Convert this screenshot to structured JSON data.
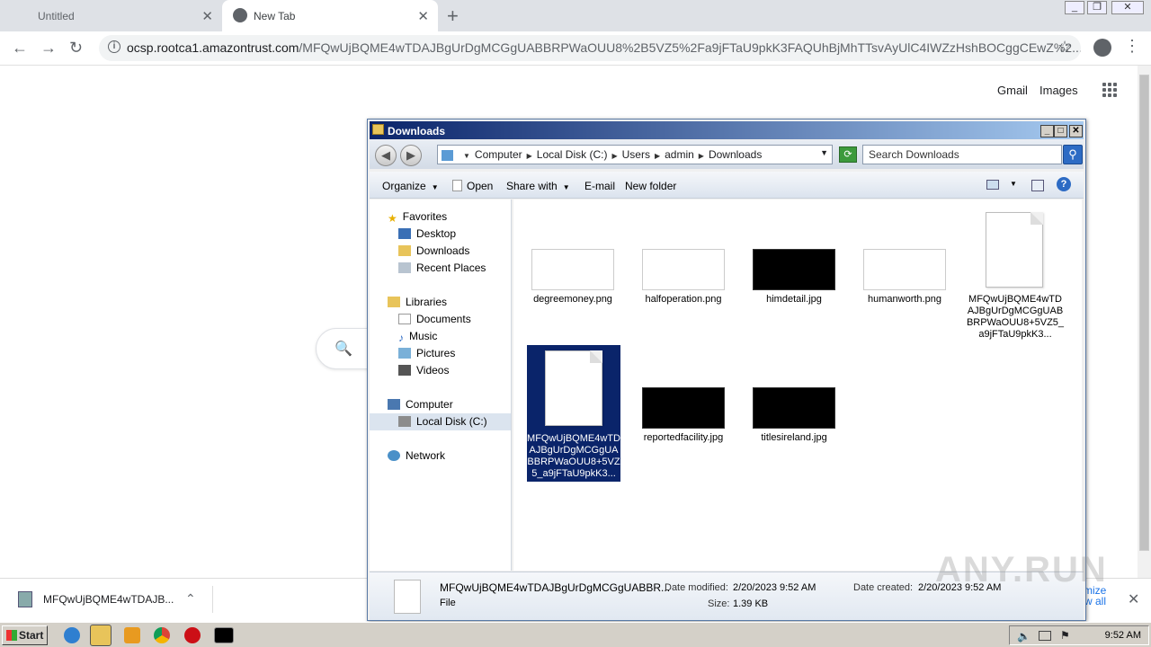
{
  "browser": {
    "tabs": [
      {
        "label": "Untitled"
      },
      {
        "label": "New Tab"
      }
    ],
    "url_host": "ocsp.rootca1.amazontrust.com",
    "url_path": "/MFQwUjBQME4wTDAJBgUrDgMCGgUABBRPWaOUU8%2B5VZ5%2Fa9jFTaU9pkK3FAQUhBjMhTTsvAyUlC4IWZzHshBOCggCEwZ%2..."
  },
  "page": {
    "gmail": "Gmail",
    "images": "Images"
  },
  "download_bar": {
    "file": "MFQwUjBQME4wTDAJB...",
    "minimize": "mize",
    "show_all": "w all"
  },
  "explorer": {
    "title": "Downloads",
    "breadcrumb": [
      "Computer",
      "Local Disk (C:)",
      "Users",
      "admin",
      "Downloads"
    ],
    "search_placeholder": "Search Downloads",
    "commands": {
      "organize": "Organize",
      "open": "Open",
      "share_with": "Share with",
      "email": "E-mail",
      "new_folder": "New folder"
    },
    "sidebar": {
      "favorites": "Favorites",
      "desktop": "Desktop",
      "downloads": "Downloads",
      "recent": "Recent Places",
      "libraries": "Libraries",
      "documents": "Documents",
      "music": "Music",
      "pictures": "Pictures",
      "videos": "Videos",
      "computer": "Computer",
      "local_disk": "Local Disk (C:)",
      "network": "Network"
    },
    "files": [
      {
        "name": "degreemoney.png"
      },
      {
        "name": "halfoperation.png"
      },
      {
        "name": "himdetail.jpg"
      },
      {
        "name": "humanworth.png"
      },
      {
        "name": "MFQwUjBQME4wTDAJBgUrDgMCGgUABBRPWaOUU8+5VZ5_a9jFTaU9pkK3..."
      },
      {
        "name": "MFQwUjBQME4wTDAJBgUrDgMCGgUABBRPWaOUU8+5VZ5_a9jFTaU9pkK3..."
      },
      {
        "name": "reportedfacility.jpg"
      },
      {
        "name": "titlesireland.jpg"
      }
    ],
    "details": {
      "name": "MFQwUjBQME4wTDAJBgUrDgMCGgUABBR...",
      "type": "File",
      "modified_label": "Date modified:",
      "modified": "2/20/2023 9:52 AM",
      "size_label": "Size:",
      "size": "1.39 KB",
      "created_label": "Date created:",
      "created": "2/20/2023 9:52 AM"
    }
  },
  "taskbar": {
    "start": "Start",
    "clock": "9:52 AM"
  },
  "watermark": "ANY.RUN"
}
